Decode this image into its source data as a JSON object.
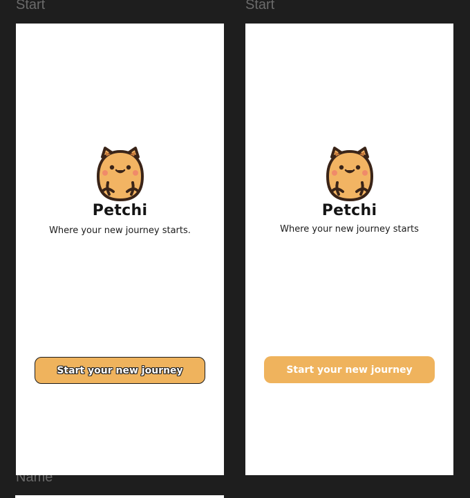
{
  "canvas": {
    "frame_label_left": "Start",
    "frame_label_right": "Start",
    "frame_label_bottom": "Name"
  },
  "screens": [
    {
      "brand": "Petchi",
      "tagline": "Where your new journey starts.",
      "cta_label": "Start your new journey"
    },
    {
      "brand": "Petchi",
      "tagline": "Where your new journey starts",
      "cta_label": "Start your new journey"
    }
  ],
  "colors": {
    "canvas_bg": "#1e1e1e",
    "accent": "#efb35d",
    "mascot_body": "#f2b463",
    "mascot_outline": "#3a2418",
    "cheeks": "#f08a6a"
  },
  "icons": {
    "mascot": "hamster-mascot-icon"
  }
}
